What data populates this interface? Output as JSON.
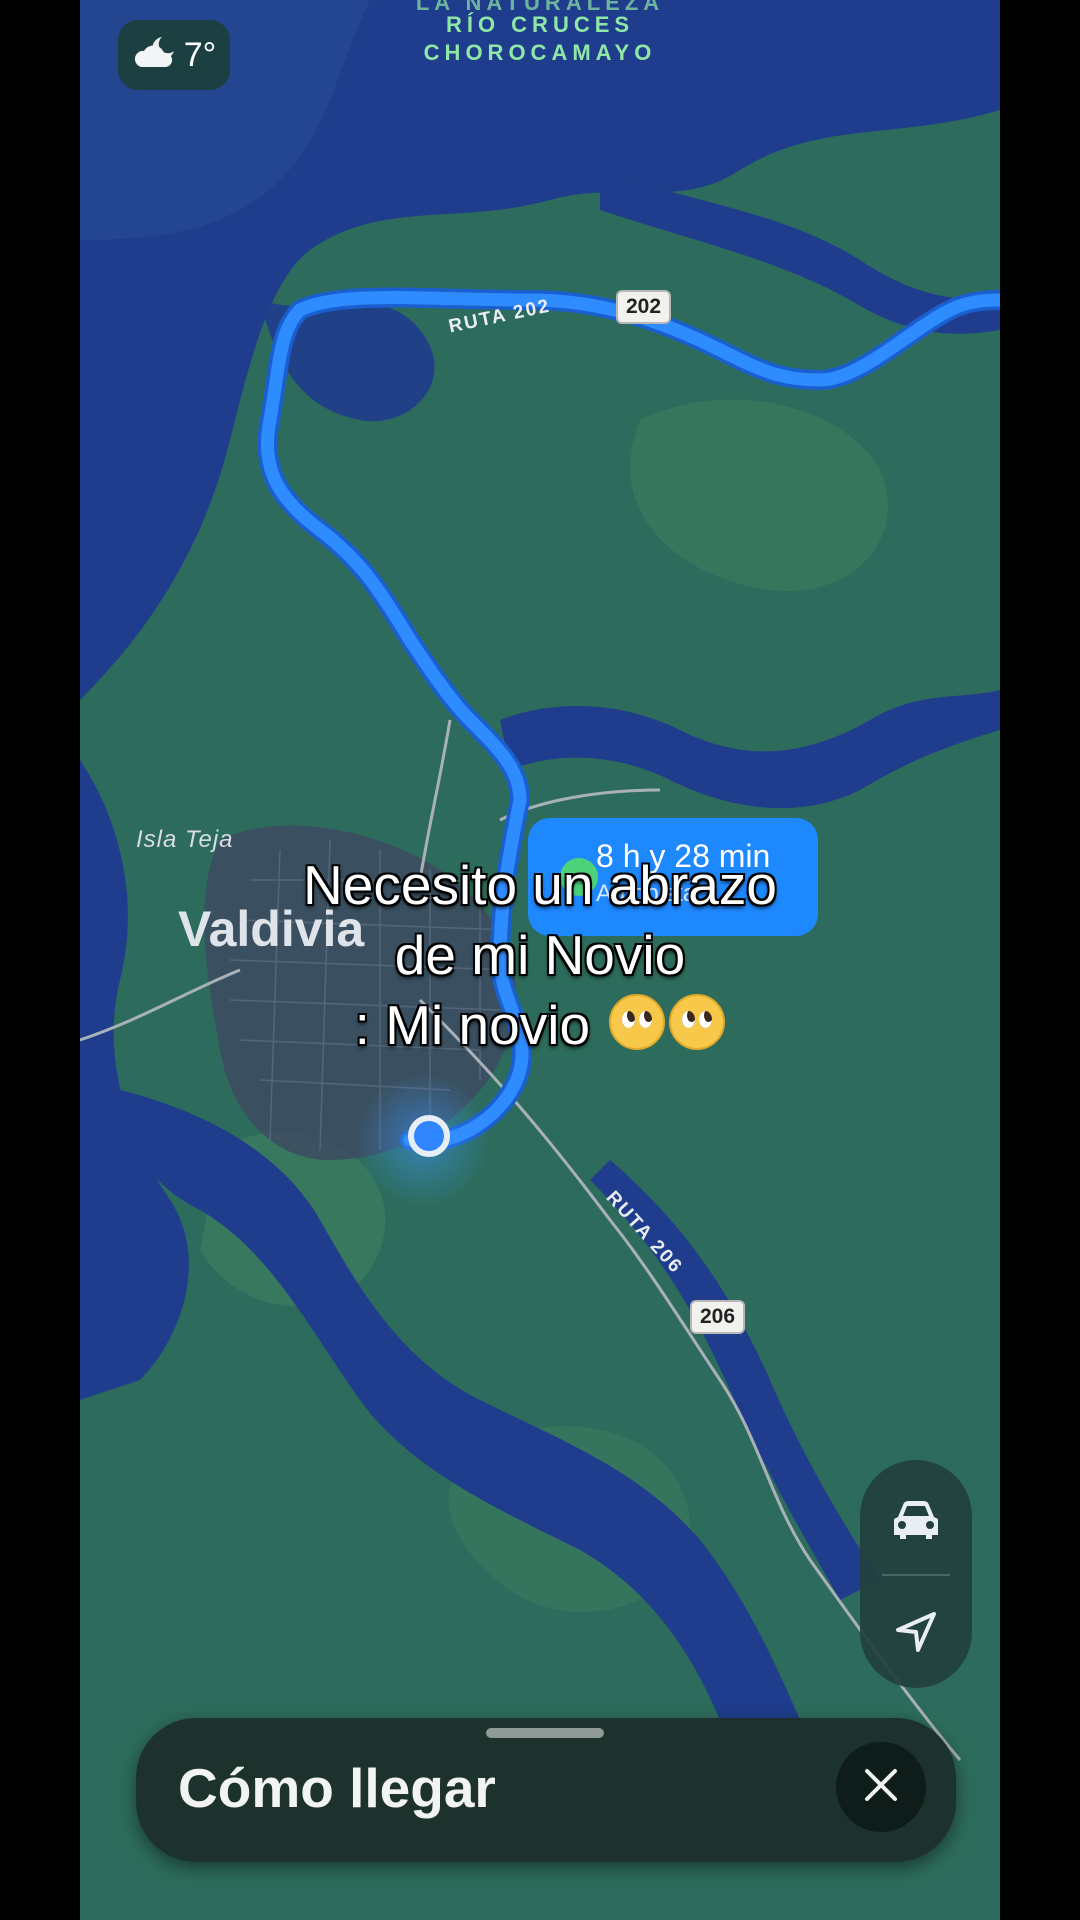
{
  "weather": {
    "icon": "cloud-moon-icon",
    "temperature": "7°"
  },
  "map": {
    "region_label_partial": "LA NATURALEZA",
    "region_line1": "RÍO CRUCES",
    "region_line2": "CHOROCAMAYO",
    "road_label_202": "RUTA 202",
    "shield_202": "202",
    "road_label_206": "RUTA 206",
    "shield_206": "206",
    "place_isla_teja": "Isla Teja",
    "place_valdivia": "Valdivia",
    "route_time": "8 h y 28 min",
    "route_sub": "Autopista"
  },
  "caption": {
    "line1": "Necesito un abrazo",
    "line2": "de mi Novio",
    "line3": ": Mi novio"
  },
  "controls": {
    "car_icon": "car-icon",
    "location_icon": "location-arrow-icon"
  },
  "sheet": {
    "title": "Cómo llegar",
    "close_icon": "close-icon"
  },
  "colors": {
    "land": "#2d6c5c",
    "water": "#1f3d8c",
    "route": "#1e88ff",
    "city": "#3d4b60"
  }
}
